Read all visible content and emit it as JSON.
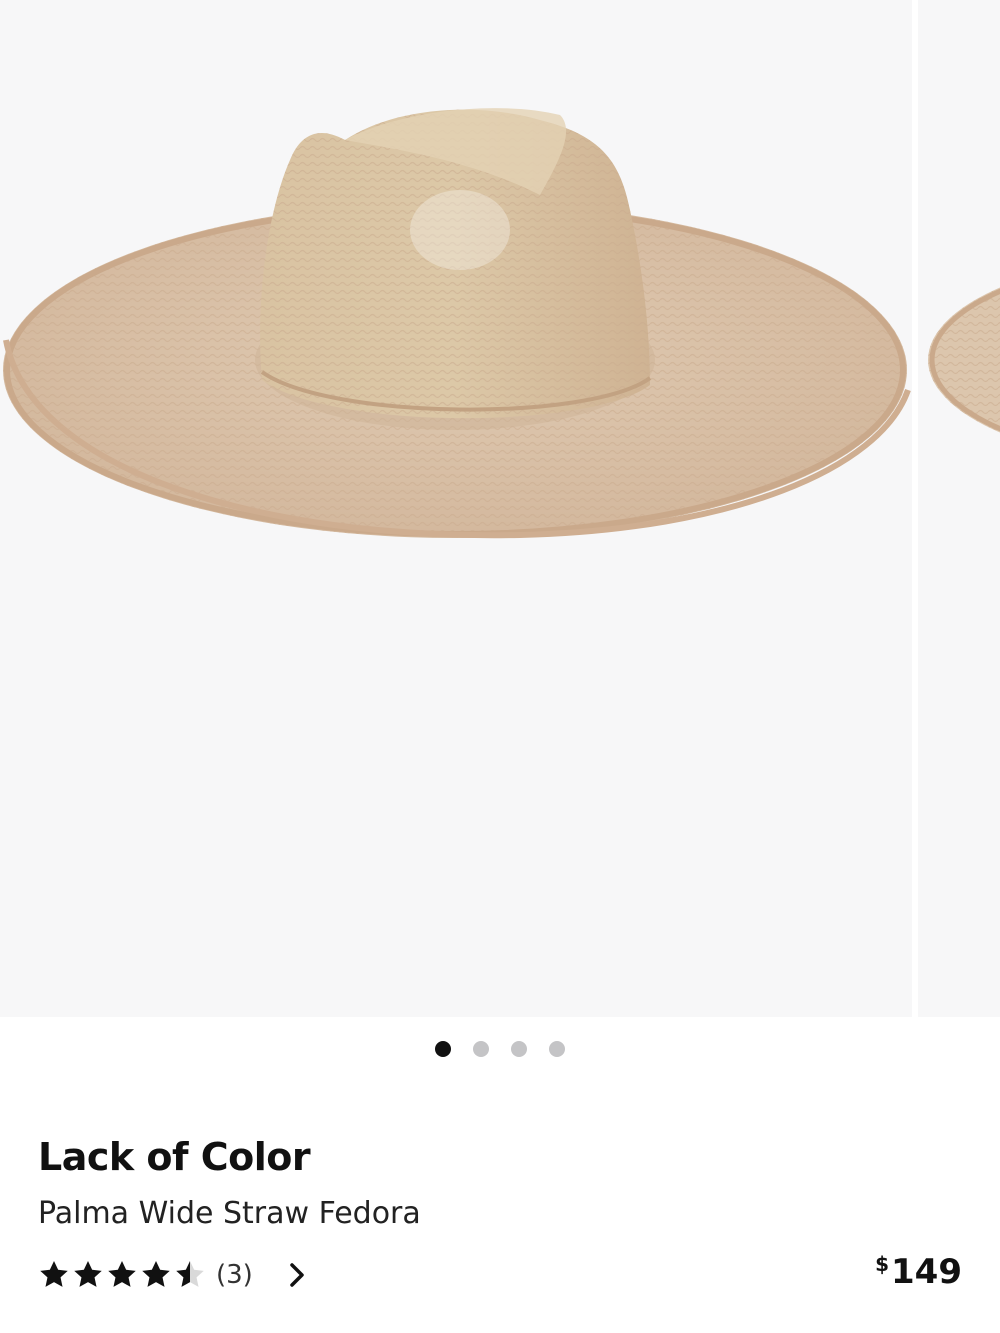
{
  "carousel": {
    "image_subject": "wide-brim straw fedora hat",
    "total_images": 4,
    "active_index": 0
  },
  "product": {
    "brand": "Lack of Color",
    "name": "Palma Wide Straw Fedora",
    "rating": 4.5,
    "rating_max": 5,
    "review_count": "(3)",
    "price_currency": "$",
    "price_amount": "149"
  },
  "colors": {
    "image_background": "#f7f7f8",
    "straw": "#d8c0a6",
    "active_dot": "#111111",
    "inactive_dot": "#c4c4c6",
    "text": "#111111"
  },
  "icons": {
    "star": "star-icon",
    "half_star": "star-half-icon",
    "chevron": "chevron-right-icon"
  }
}
